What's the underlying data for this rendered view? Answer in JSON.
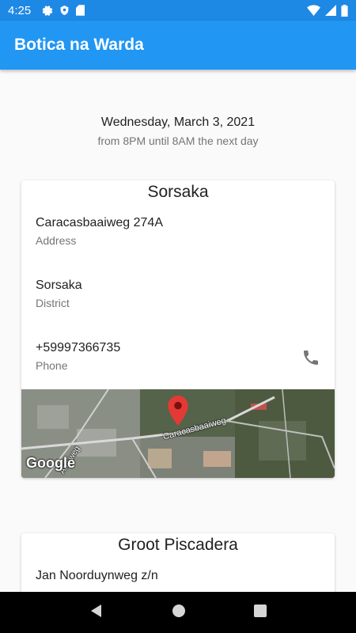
{
  "status_bar": {
    "time": "4:25",
    "left_icons": [
      "gear-icon",
      "shield-icon",
      "sd-card-icon"
    ],
    "right_icons": [
      "wifi-icon",
      "cell-signal-icon",
      "battery-icon"
    ]
  },
  "app_bar": {
    "title": "Botica na Warda"
  },
  "schedule": {
    "date": "Wednesday, March 3, 2021",
    "hours": "from 8PM until 8AM the next day"
  },
  "pharmacies": [
    {
      "name": "Sorsaka",
      "address": "Caracasbaaiweg 274A",
      "address_label": "Address",
      "district": "Sorsaka",
      "district_label": "District",
      "phone": "+59997366735",
      "phone_label": "Phone",
      "map": {
        "road_label_1": "Caracasbaaiweg",
        "road_label_2": "Ana weg",
        "logo": "Google"
      }
    },
    {
      "name": "Groot Piscadera",
      "address": "Jan Noorduynweg z/n"
    }
  ],
  "nav_bar": {
    "icons": [
      "back-icon",
      "home-icon",
      "recents-icon"
    ]
  }
}
